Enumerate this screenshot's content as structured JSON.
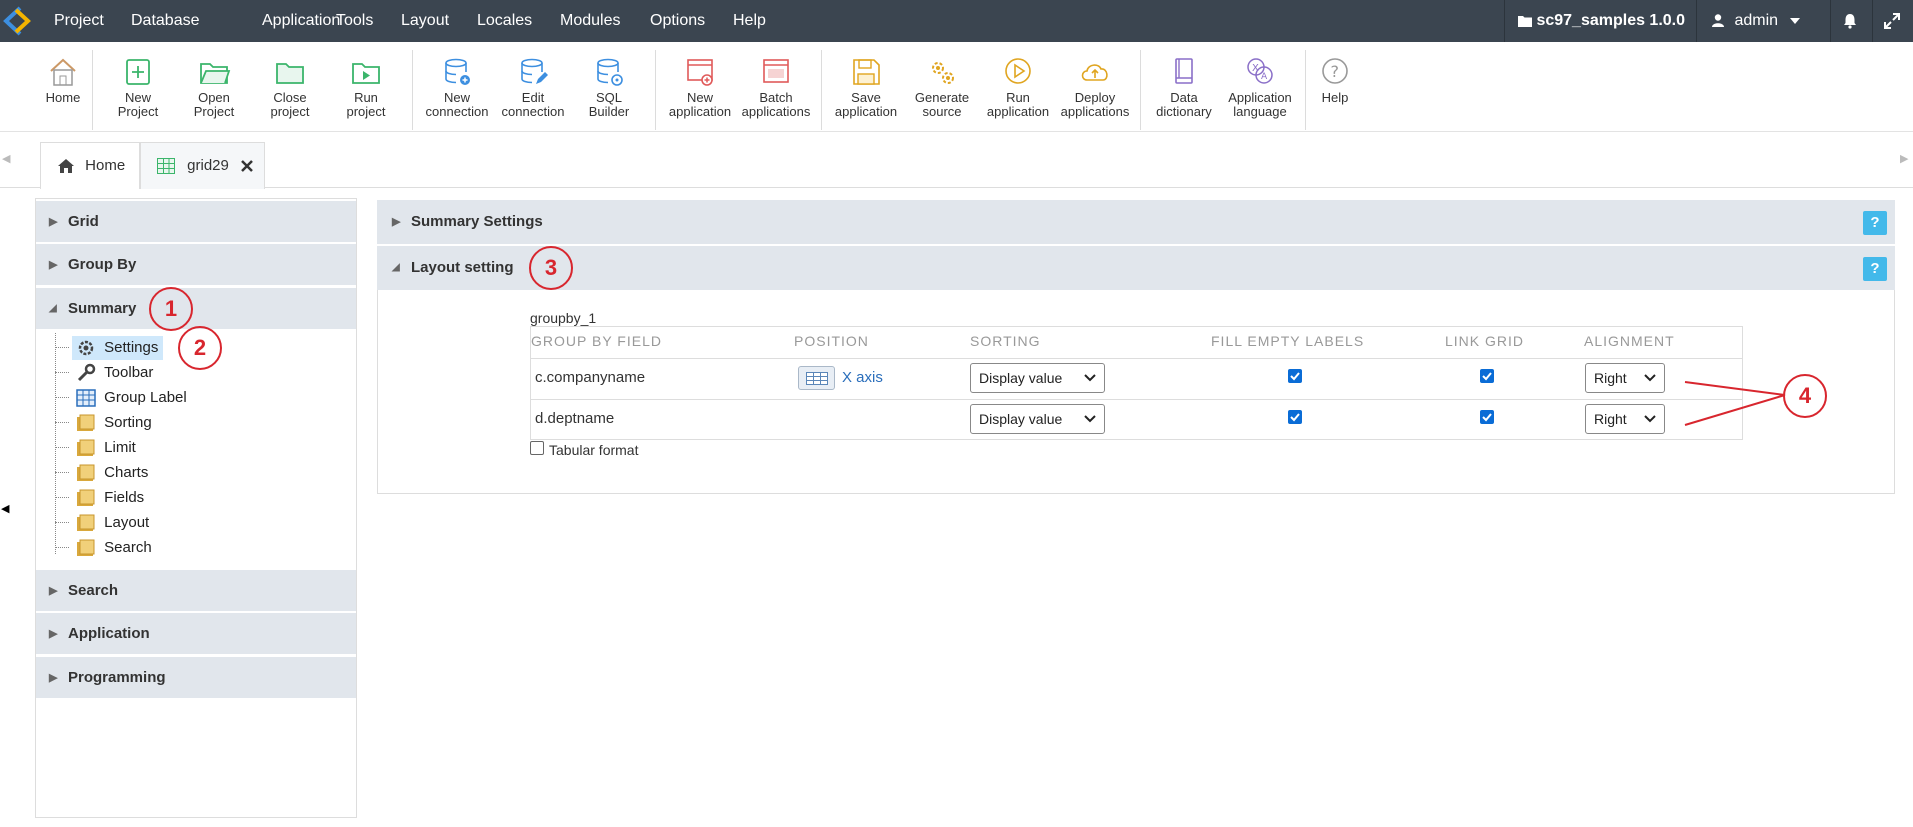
{
  "menubar": {
    "items": [
      "Project",
      "Database",
      "Application",
      "Tools",
      "Layout",
      "Locales",
      "Modules",
      "Options",
      "Help"
    ],
    "project_name": "sc97_samples 1.0.0",
    "user": "admin",
    "bg_color": "#3b4550"
  },
  "toolbar": {
    "home": [
      "Home",
      ""
    ],
    "new_project": [
      "New",
      "Project"
    ],
    "open_project": [
      "Open",
      "Project"
    ],
    "close_project": [
      "Close",
      "project"
    ],
    "run_project": [
      "Run",
      "project"
    ],
    "new_connection": [
      "New",
      "connection"
    ],
    "edit_connection": [
      "Edit",
      "connection"
    ],
    "sql_builder": [
      "SQL",
      "Builder"
    ],
    "new_application": [
      "New",
      "application"
    ],
    "batch_applications": [
      "Batch",
      "applications"
    ],
    "save_application": [
      "Save",
      "application"
    ],
    "generate_source": [
      "Generate",
      "source"
    ],
    "run_application": [
      "Run",
      "application"
    ],
    "deploy_applications": [
      "Deploy",
      "applications"
    ],
    "data_dictionary": [
      "Data",
      "dictionary"
    ],
    "application_language": [
      "Application",
      "language"
    ],
    "help": [
      "Help",
      ""
    ]
  },
  "tabs": {
    "home": "Home",
    "grid": "grid29"
  },
  "left_panel": {
    "sections": {
      "grid": "Grid",
      "group_by": "Group By",
      "summary": "Summary",
      "search": "Search",
      "application": "Application",
      "programming": "Programming"
    },
    "tree": [
      "Settings",
      "Toolbar",
      "Group Label",
      "Sorting",
      "Limit",
      "Charts",
      "Fields",
      "Layout",
      "Search"
    ]
  },
  "right_panel": {
    "summary_settings": "Summary Settings",
    "layout_setting": "Layout setting",
    "help": "?",
    "groupby_name": "groupby_1",
    "headers": {
      "field": "GROUP BY FIELD",
      "position": "POSITION",
      "sorting": "SORTING",
      "fill_empty": "FILL EMPTY LABELS",
      "link_grid": "LINK GRID",
      "alignment": "ALIGNMENT"
    },
    "rows": [
      {
        "field": "c.companyname",
        "position": "X axis",
        "sorting": "Display value",
        "fill_empty": true,
        "link_grid": true,
        "alignment": "Right"
      },
      {
        "field": "d.deptname",
        "position": "",
        "sorting": "Display value",
        "fill_empty": true,
        "link_grid": true,
        "alignment": "Right"
      }
    ],
    "tabular_format": "Tabular format"
  },
  "annotations": [
    "1",
    "2",
    "3",
    "4"
  ],
  "colors": {
    "annotation_red": "#d8262e",
    "help_blue": "#43b9ea",
    "section_bg": "#e1e6ec",
    "link_blue": "#2a6ebb"
  }
}
